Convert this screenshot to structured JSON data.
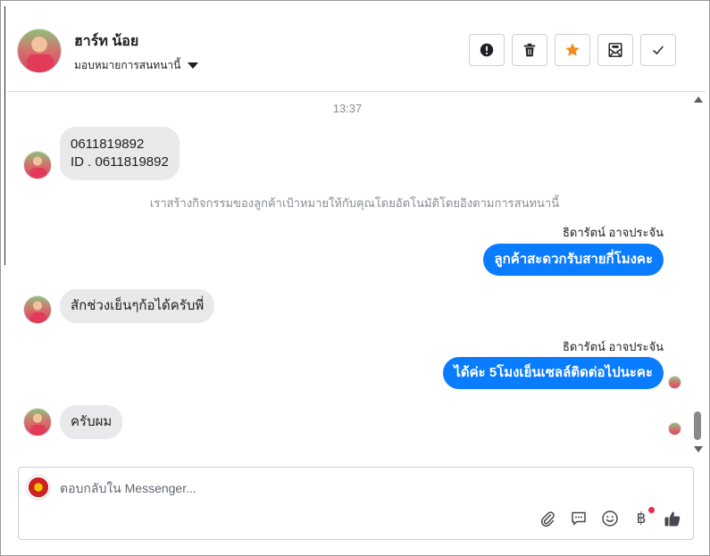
{
  "header": {
    "contact_name": "ฮาร์ท น้อย",
    "assign_label": "มอบหมายการสนทนานี้",
    "actions": [
      {
        "name": "spam",
        "icon": "exclamation-circle-icon"
      },
      {
        "name": "delete",
        "icon": "trash-icon"
      },
      {
        "name": "star",
        "icon": "star-icon",
        "color": "#f28b1d"
      },
      {
        "name": "mark-unread",
        "icon": "envelope-icon"
      },
      {
        "name": "done",
        "icon": "check-icon"
      }
    ]
  },
  "thread": {
    "timestamp": "13:37",
    "msg1_line1": "0611819892",
    "msg1_line2": "ID . 0611819892",
    "system_note": "เราสร้างกิจกรรมของลูกค้าเป้าหมายให้กับคุณโดยอัตโนมัติโดยอิงตามการสนทนานี้",
    "sender_name_1": "ธิดารัตน์ อาจประจัน",
    "msg2": "ลูกค้าสะดวกรับสายกี่โมงคะ",
    "msg3": "สักช่วงเย็นๆก้อได้ครับพี่",
    "sender_name_2": "ธิดารัตน์ อาจประจัน",
    "msg4": "ได้ค่ะ 5โมงเย็นเซลล์ติดต่อไปนะคะ",
    "msg5": "ครับผม"
  },
  "composer": {
    "placeholder": "ตอบกลับใน Messenger...",
    "baht_symbol": "฿",
    "tools": [
      "paperclip-icon",
      "chat-bubble-icon",
      "smiley-icon",
      "baht-icon",
      "thumbs-up-icon"
    ]
  },
  "colors": {
    "outgoing_bubble": "#0a7cff",
    "incoming_bubble": "#e9e9eb",
    "star": "#f28b1d",
    "thumbs_up": "#444950"
  }
}
